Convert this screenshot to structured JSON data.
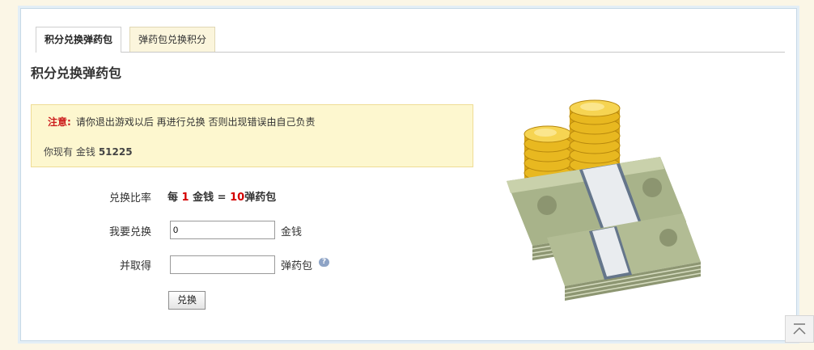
{
  "tabs": [
    {
      "label": "积分兑换弹药包",
      "active": true
    },
    {
      "label": "弹药包兑换积分",
      "active": false
    }
  ],
  "page_title": "积分兑换弹药包",
  "notice": {
    "label": "注意:",
    "text": "请你退出游戏以后 再进行兑换 否则出现错误由自己负责",
    "balance_prefix": "你现有 金钱",
    "balance_value": "51225"
  },
  "form": {
    "rate_label": "兑换比率",
    "rate": {
      "prefix": "每",
      "from": "1",
      "from_unit": "金钱",
      "equals": "=",
      "to": "10",
      "to_unit": "弹药包"
    },
    "exchange_label": "我要兑换",
    "exchange_value": "0",
    "exchange_unit": "金钱",
    "receive_label": "并取得",
    "receive_value": "",
    "receive_unit": "弹药包",
    "help_icon": "question-icon",
    "submit_label": "兑换"
  },
  "colors": {
    "accent_red": "#d40000",
    "notice_bg": "#fdf7cf",
    "tab_inactive_bg": "#fbf5dc"
  }
}
